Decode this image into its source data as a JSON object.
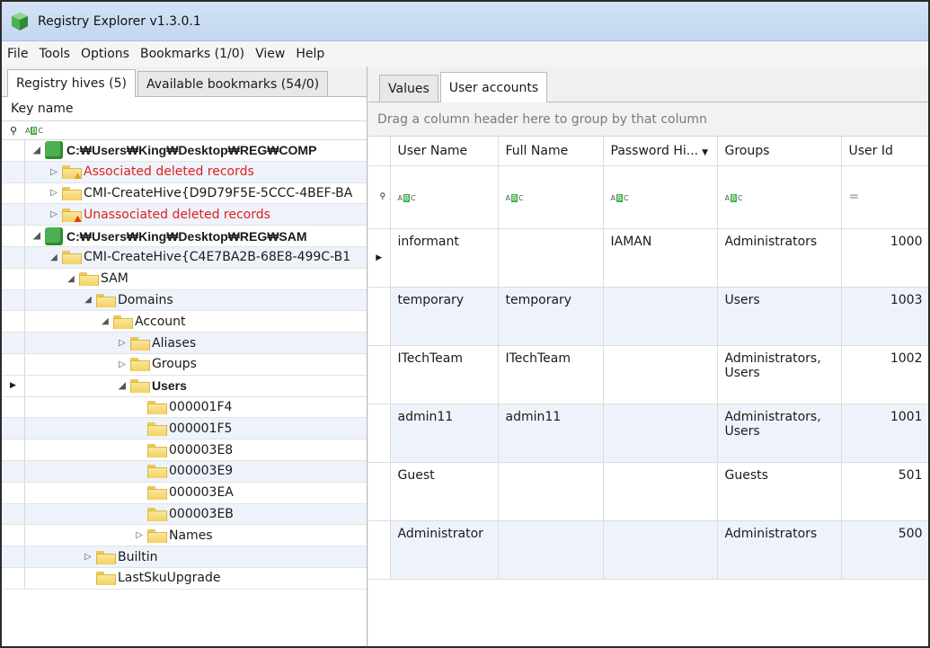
{
  "window": {
    "title": "Registry Explorer v1.3.0.1"
  },
  "menu": [
    "File",
    "Tools",
    "Options",
    "Bookmarks (1/0)",
    "View",
    "Help"
  ],
  "left_tabs": {
    "hives": "Registry hives (5)",
    "bookmarks": "Available bookmarks (54/0)"
  },
  "tree_header": {
    "key_name": "Key name"
  },
  "tree": [
    {
      "label": "C:\\Users\\King\\Desktop\\REG\\COMP",
      "display": "C:₩Users₩King₩Desktop₩REG₩COMP",
      "level": 0,
      "icon": "hive-icon",
      "exp": "◢",
      "style": "bold"
    },
    {
      "label": "Associated deleted records",
      "level": 1,
      "icon": "folder-warning-icon",
      "exp": "▷",
      "style": "red"
    },
    {
      "label": "CMI-CreateHive{D9D79F5E-5CCC-4BEF-BA",
      "level": 1,
      "icon": "folder-icon",
      "exp": "▷",
      "style": ""
    },
    {
      "label": "Unassociated deleted records",
      "level": 1,
      "icon": "folder-error-icon",
      "exp": "▷",
      "style": "red"
    },
    {
      "label": "C:\\Users\\King\\Desktop\\REG\\SAM",
      "display": "C:₩Users₩King₩Desktop₩REG₩SAM",
      "level": 0,
      "icon": "hive-icon",
      "exp": "◢",
      "style": "bold"
    },
    {
      "label": "CMI-CreateHive{C4E7BA2B-68E8-499C-B1",
      "level": 1,
      "icon": "folder-icon",
      "exp": "◢",
      "style": ""
    },
    {
      "label": "SAM",
      "level": 2,
      "icon": "folder-icon",
      "exp": "◢",
      "style": ""
    },
    {
      "label": "Domains",
      "level": 3,
      "icon": "folder-icon",
      "exp": "◢",
      "style": ""
    },
    {
      "label": "Account",
      "level": 4,
      "icon": "folder-icon",
      "exp": "◢",
      "style": ""
    },
    {
      "label": "Aliases",
      "level": 5,
      "icon": "folder-icon",
      "exp": "▷",
      "style": ""
    },
    {
      "label": "Groups",
      "level": 5,
      "icon": "folder-icon",
      "exp": "▷",
      "style": ""
    },
    {
      "label": "Users",
      "level": 5,
      "icon": "folder-icon",
      "exp": "◢",
      "style": "bold",
      "selected": true
    },
    {
      "label": "000001F4",
      "level": 6,
      "icon": "folder-icon",
      "exp": "",
      "style": ""
    },
    {
      "label": "000001F5",
      "level": 6,
      "icon": "folder-icon",
      "exp": "",
      "style": ""
    },
    {
      "label": "000003E8",
      "level": 6,
      "icon": "folder-icon",
      "exp": "",
      "style": ""
    },
    {
      "label": "000003E9",
      "level": 6,
      "icon": "folder-icon",
      "exp": "",
      "style": ""
    },
    {
      "label": "000003EA",
      "level": 6,
      "icon": "folder-icon",
      "exp": "",
      "style": ""
    },
    {
      "label": "000003EB",
      "level": 6,
      "icon": "folder-icon",
      "exp": "",
      "style": ""
    },
    {
      "label": "Names",
      "level": 6,
      "icon": "folder-icon",
      "exp": "▷",
      "style": ""
    },
    {
      "label": "Builtin",
      "level": 3,
      "icon": "folder-icon",
      "exp": "▷",
      "style": ""
    },
    {
      "label": "LastSkuUpgrade",
      "level": 3,
      "icon": "folder-icon",
      "exp": "",
      "style": ""
    }
  ],
  "right_tabs": {
    "values": "Values",
    "user_accounts": "User accounts"
  },
  "group_panel": "Drag a column header here to group by that column",
  "columns": [
    "User Name",
    "Full Name",
    "Password Hi...",
    "Groups",
    "User Id"
  ],
  "users": [
    {
      "user_name": "informant",
      "full_name": "",
      "password_hint": "IAMAN",
      "groups": "Administrators",
      "user_id": "1000",
      "current": true
    },
    {
      "user_name": "temporary",
      "full_name": "temporary",
      "password_hint": "",
      "groups": "Users",
      "user_id": "1003"
    },
    {
      "user_name": "ITechTeam",
      "full_name": "ITechTeam",
      "password_hint": "",
      "groups": "Administrators, Users",
      "user_id": "1002"
    },
    {
      "user_name": "admin11",
      "full_name": "admin11",
      "password_hint": "",
      "groups": "Administrators, Users",
      "user_id": "1001"
    },
    {
      "user_name": "Guest",
      "full_name": "",
      "password_hint": "",
      "groups": "Guests",
      "user_id": "501"
    },
    {
      "user_name": "Administrator",
      "full_name": "",
      "password_hint": "",
      "groups": "Administrators",
      "user_id": "500"
    }
  ],
  "colors": {
    "titlebar": "#c9dbf2",
    "alt_row": "#eef3fb",
    "deleted_text": "#e0201b",
    "hive_green": "#4caf50"
  }
}
